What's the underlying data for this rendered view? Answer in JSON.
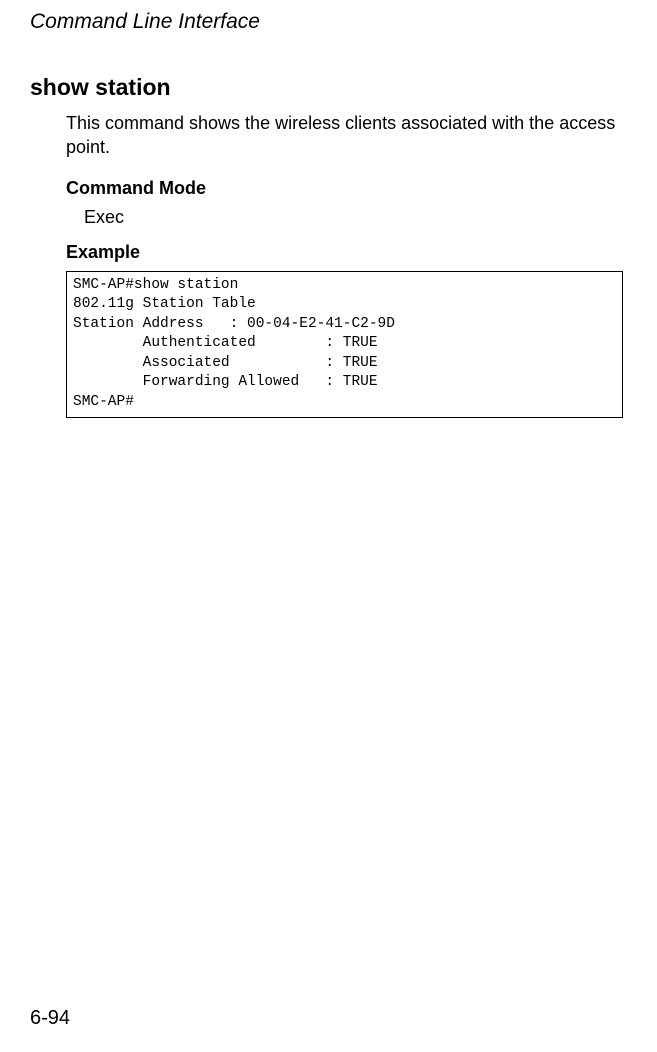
{
  "header": {
    "running_title": "Command Line Interface"
  },
  "section": {
    "command_name": "show station",
    "description": "This command shows the wireless clients associated with the access point.",
    "command_mode_label": "Command Mode",
    "command_mode_value": "Exec",
    "example_label": "Example",
    "example_output": "SMC-AP#show station\n802.11g Station Table\nStation Address   : 00-04-E2-41-C2-9D\n        Authenticated        : TRUE\n        Associated           : TRUE\n        Forwarding Allowed   : TRUE\nSMC-AP#"
  },
  "footer": {
    "page_number": "6-94"
  }
}
